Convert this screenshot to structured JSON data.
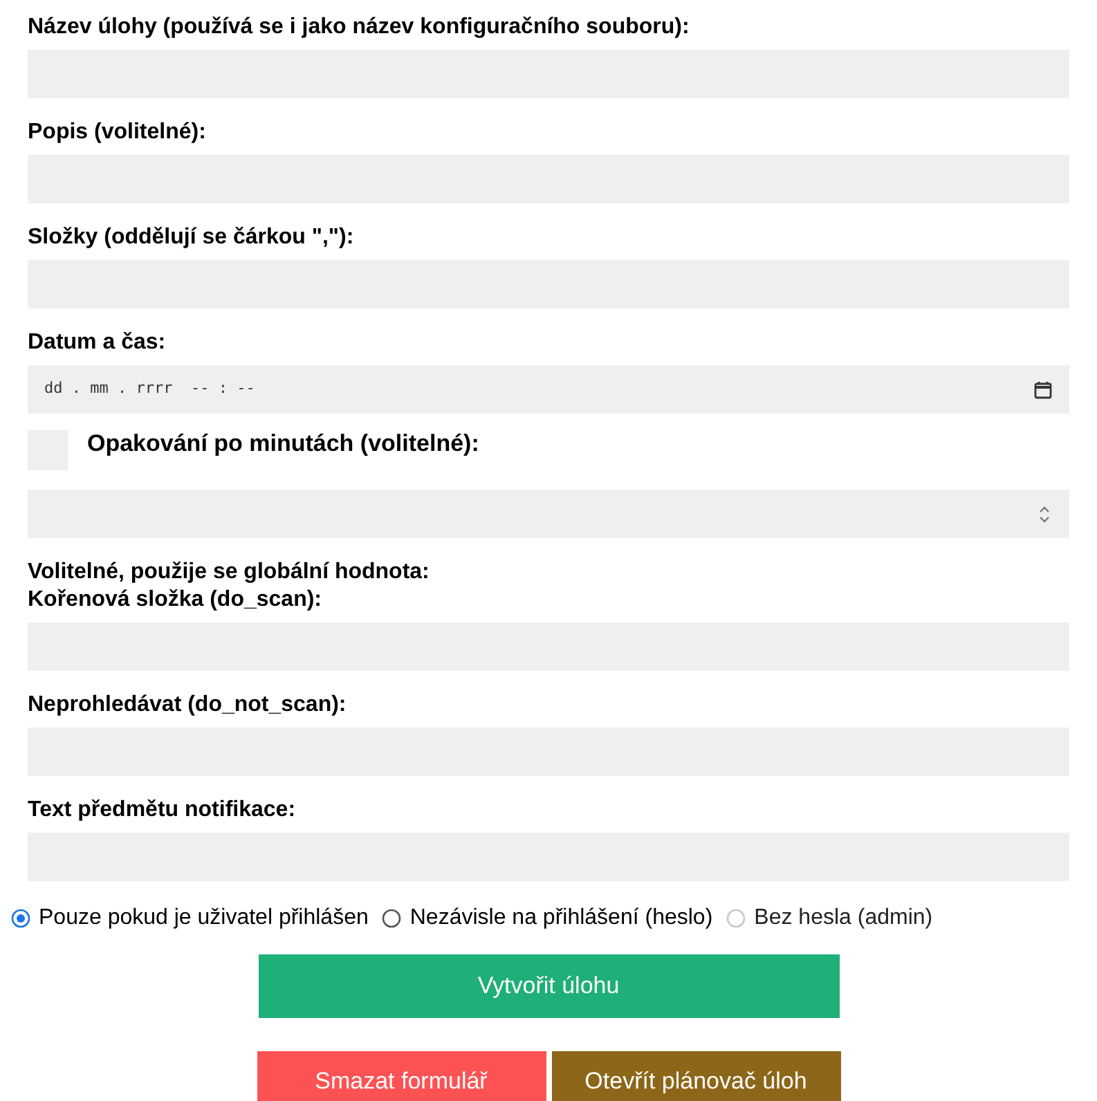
{
  "fields": [
    {
      "kind": "text",
      "label": "Název úlohy (používá se i jako název konfiguračního souboru):"
    },
    {
      "kind": "text",
      "label": "Popis (volitelné):"
    },
    {
      "kind": "text",
      "label": "Složky (oddělují se čárkou \",\"):"
    },
    {
      "kind": "datetime",
      "label": "Datum a čas:",
      "placeholder": "dd . mm . rrrr  -- : --"
    },
    {
      "kind": "checkbox",
      "label": "Opakování po minutách (volitelné):",
      "checked": false
    },
    {
      "kind": "number"
    },
    {
      "kind": "text",
      "label": "Volitelné, použije se globální hodnota:",
      "label_2": "Kořenová složka (do_scan):"
    },
    {
      "kind": "text",
      "label": "Neprohledávat (do_not_scan):"
    },
    {
      "kind": "text",
      "label": "Text předmětu notifikace:"
    }
  ],
  "radios": [
    {
      "label": "Pouze pokud je uživatel přihlášen",
      "selected": true,
      "disabled": false
    },
    {
      "label": "Nezávisle na přihlášení (heslo)",
      "selected": false,
      "disabled": false
    },
    {
      "label": "Bez hesla (admin)",
      "selected": false,
      "disabled": true
    }
  ],
  "create_button": "Vytvořit úlohu",
  "clear_button": "Smazat formulář",
  "scheduler_button": "Otevřít plánovač úloh"
}
